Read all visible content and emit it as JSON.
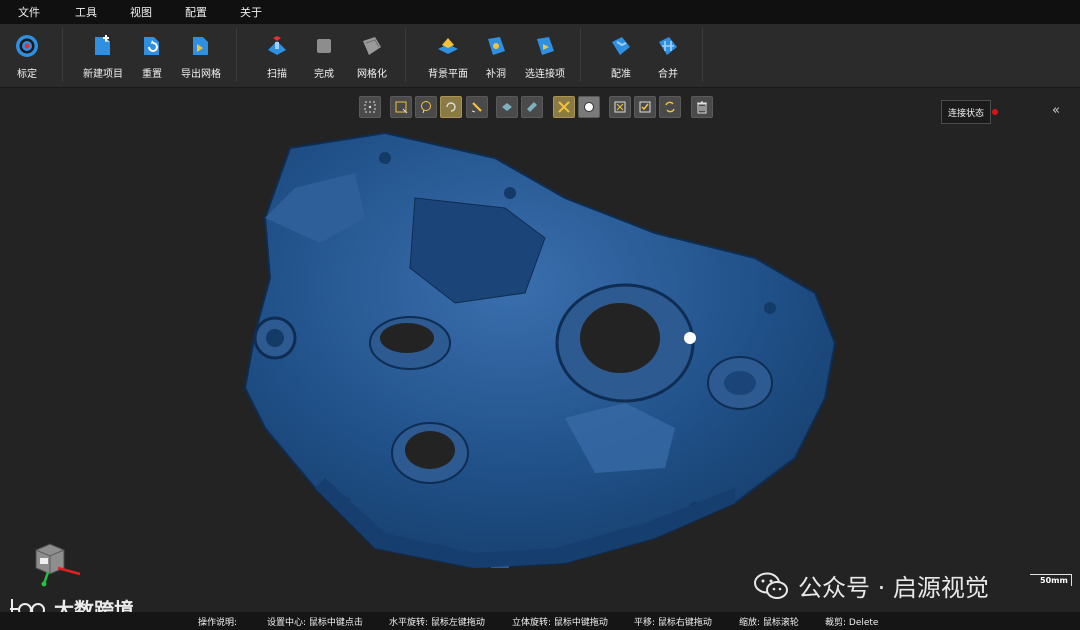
{
  "menu": [
    "文件",
    "工具",
    "视图",
    "配置",
    "关于"
  ],
  "toolbar": {
    "calibrate": "标定",
    "new_project": "新建项目",
    "reset": "重置",
    "export_mesh": "导出网格",
    "scan": "扫描",
    "finish": "完成",
    "mesh": "网格化",
    "background_plane": "背景平面",
    "fill_holes": "补洞",
    "select_connected": "选连接项",
    "register": "配准",
    "merge": "合并"
  },
  "connection": {
    "label": "连接状态",
    "status_color": "#e01010"
  },
  "scale_bar": "50mm",
  "watermark": {
    "wechat": "公众号 · 启源视觉",
    "logo_text": "大数跨境"
  },
  "status": {
    "help": "操作说明:",
    "set_center": "设置中心: 鼠标中键点击",
    "h_rotate": "水平旋转: 鼠标左键拖动",
    "rotate_3d": "立体旋转: 鼠标中键拖动",
    "pan": "平移: 鼠标右键拖动",
    "zoom": "缩放: 鼠标滚轮",
    "crop": "裁剪: Delete"
  },
  "colors": {
    "model": "#1f4f86",
    "accent": "#2f8fe0",
    "background": "#232323"
  }
}
